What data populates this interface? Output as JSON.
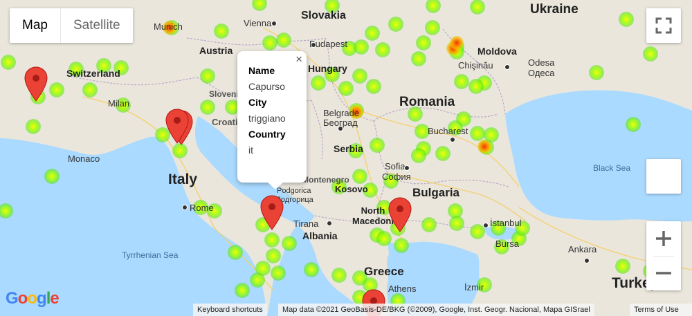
{
  "map": {
    "type_toggle": {
      "map_label": "Map",
      "satellite_label": "Satellite"
    },
    "country_labels": [
      "Slovakia",
      "Ukraine",
      "Austria",
      "Hungary",
      "Moldova",
      "Switzerland",
      "Romania",
      "Serbia",
      "Italy",
      "Bulgaria",
      "Greece",
      "Albania",
      "Kosovo",
      "North Macedonia",
      "Turkey"
    ],
    "city_labels": [
      "Vienna",
      "Budapest",
      "Chişinău",
      "Odesa",
      "Одеса",
      "Milan",
      "Belgrade",
      "Београд",
      "Bucharest",
      "Monaco",
      "Rome",
      "Sofia",
      "София",
      "Tirana",
      "Podgorica",
      "Подгорица",
      "İstanbul",
      "Bursa",
      "Ankara",
      "Athens",
      "İzmir",
      "Munich",
      "Slovenia",
      "Croatia",
      "Montenegro"
    ],
    "sea_labels": [
      "Black Sea",
      "Tyrrhenian Sea"
    ],
    "info_window": {
      "name_label": "Name",
      "name_value": "Capurso",
      "city_label": "City",
      "city_value": "triggiano",
      "country_label": "Country",
      "country_value": "it"
    },
    "footer": {
      "shortcuts": "Keyboard shortcuts",
      "attribution": "Map data ©2021 GeoBasis-DE/BKG (©2009), Google, Inst. Geogr. Nacional, Mapa GISrael",
      "terms": "Terms of Use"
    },
    "logo": [
      "G",
      "o",
      "o",
      "g",
      "l",
      "e"
    ],
    "colors": {
      "land": "#eae6dc",
      "water": "#aadaff",
      "marker": "#ea4335",
      "heat_low": "#7dff00",
      "heat_high": "#ff3b00"
    }
  }
}
